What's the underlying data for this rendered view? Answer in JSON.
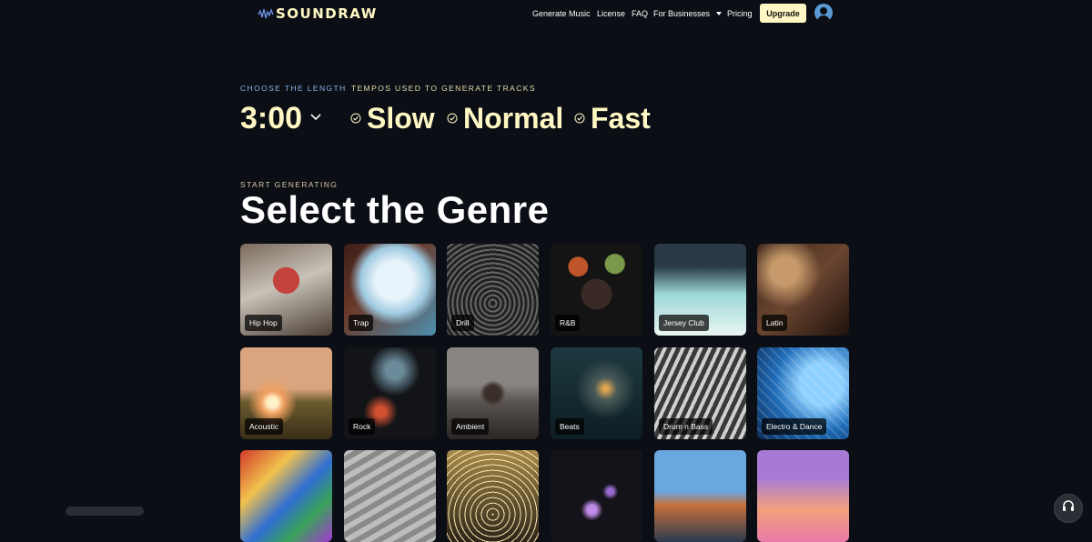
{
  "brand": {
    "name": "SOUNDRAW",
    "accent": "#fff8c4"
  },
  "nav": {
    "generate_music": "Generate Music",
    "license": "License",
    "faq": "FAQ",
    "for_businesses": "For Businesses",
    "pricing": "Pricing",
    "upgrade": "Upgrade",
    "avatar_icon": "user-avatar-icon"
  },
  "length": {
    "label": "CHOOSE THE LENGTH",
    "value": "3:00"
  },
  "tempos": {
    "label": "TEMPOS USED TO GENERATE TRACKS",
    "items": [
      {
        "name": "Slow",
        "checked": true
      },
      {
        "name": "Normal",
        "checked": true
      },
      {
        "name": "Fast",
        "checked": true
      }
    ]
  },
  "genres": {
    "eyebrow": "START GENERATING",
    "title": "Select the Genre",
    "items": [
      "Hip Hop",
      "Trap",
      "Drill",
      "R&B",
      "Jersey Club",
      "Latin",
      "Acoustic",
      "Rock",
      "Ambient",
      "Beats",
      "Drum n Bass",
      "Electro & Dance"
    ]
  }
}
